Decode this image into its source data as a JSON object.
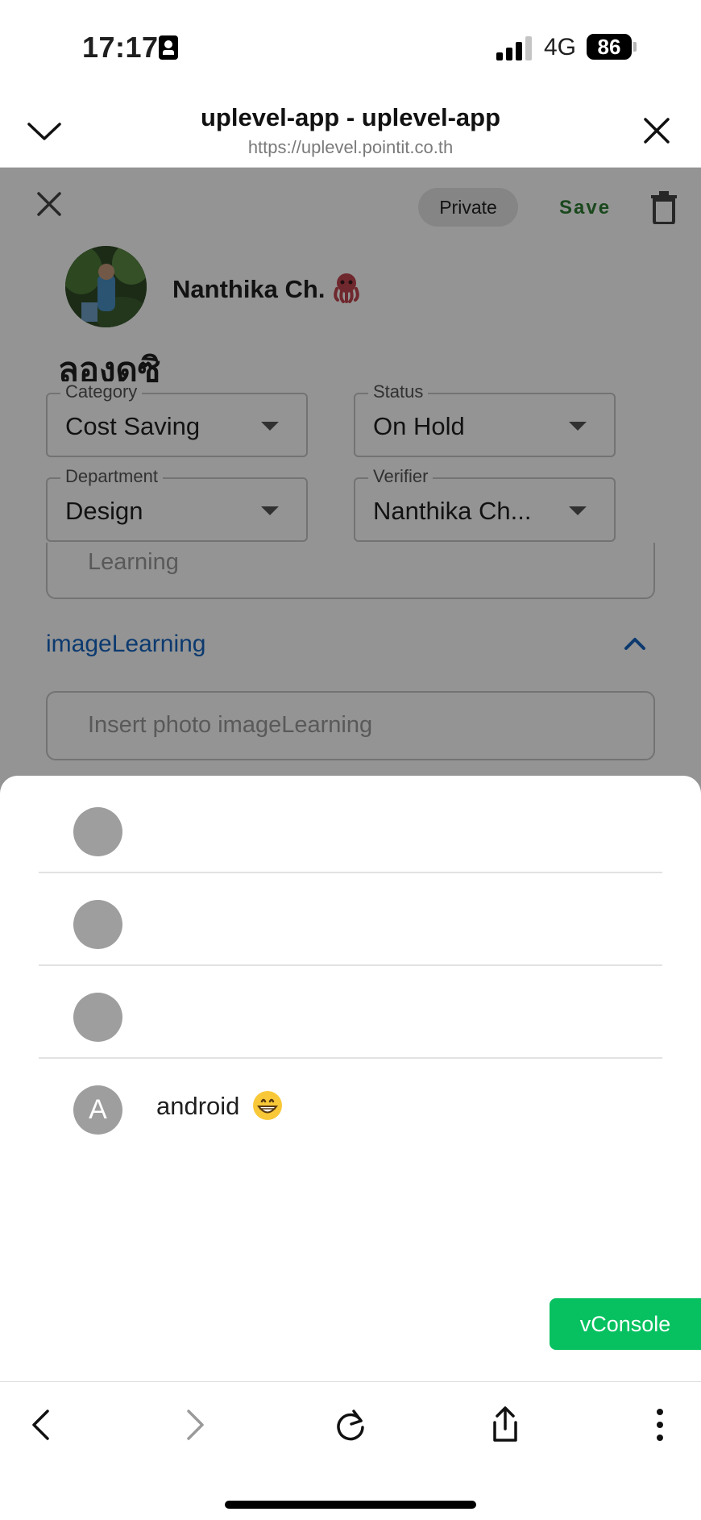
{
  "status_bar": {
    "time": "17:17",
    "network": "4G",
    "battery": "86"
  },
  "browser": {
    "title": "uplevel-app - uplevel-app",
    "url": "https://uplevel.pointit.co.th"
  },
  "page": {
    "private_label": "Private",
    "save_label": "Save",
    "user_name": "Nanthika Ch.",
    "user_emoji": "octopus-icon",
    "title": "ลองดูซิ",
    "fields": [
      {
        "label": "Category",
        "value": "Cost Saving"
      },
      {
        "label": "Status",
        "value": "On Hold"
      },
      {
        "label": "Department",
        "value": "Design"
      },
      {
        "label": "Verifier",
        "value": "Nanthika Ch..."
      }
    ],
    "learning_placeholder": "Learning",
    "image_learning_label": "imageLearning",
    "photo_placeholder": "Insert photo imageLearning"
  },
  "sheet": {
    "items": [
      {
        "initial": "",
        "name": ""
      },
      {
        "initial": "",
        "name": ""
      },
      {
        "initial": "",
        "name": ""
      },
      {
        "initial": "A",
        "name": "android",
        "emoji": "grinning-face-icon"
      }
    ]
  },
  "vconsole_label": "vConsole",
  "colors": {
    "save": "#2e7d32",
    "link": "#1565c0",
    "vconsole": "#07c160",
    "avatar_placeholder": "#9e9e9e"
  }
}
